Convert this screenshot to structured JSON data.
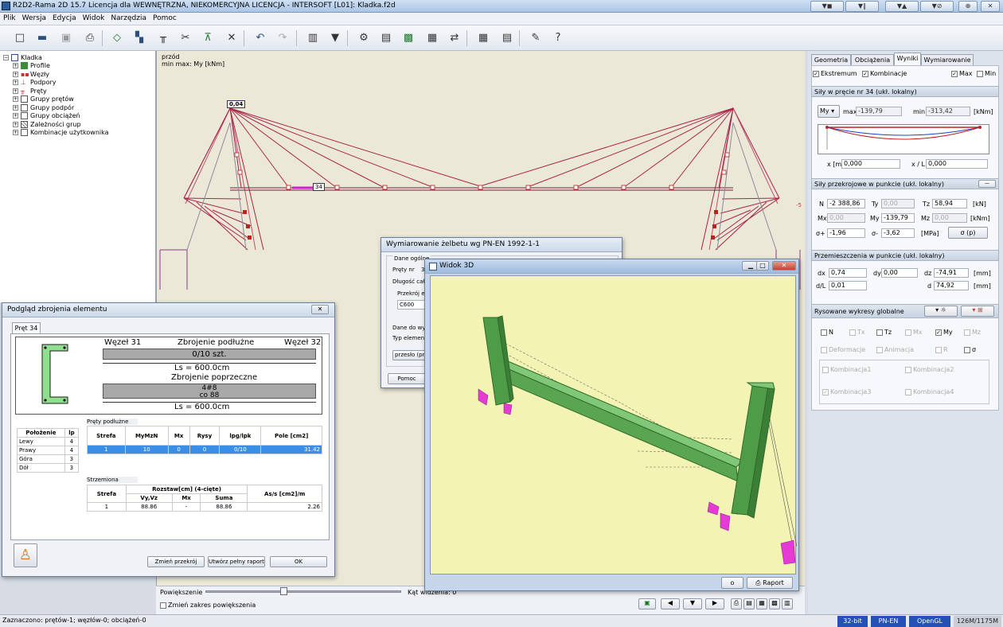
{
  "window": {
    "title": "R2D2-Rama 2D 15.7 Licencja dla WEWNĘTRZNA, NIEKOMERCYJNA LICENCJA - INTERSOFT [L01]: Kladka.f2d",
    "title_buttons": [
      "▼◼",
      "▼∥",
      "▼▲",
      "▼⊘",
      "⊕",
      "✕"
    ]
  },
  "menu": [
    "Plik",
    "Wersja",
    "Edycja",
    "Widok",
    "Narzędzia",
    "Pomoc"
  ],
  "toolbar_icons": [
    "new-file-icon",
    "open-folder-icon",
    "save-icon",
    "print-icon",
    "add-node-icon",
    "move-icon",
    "add-beam-icon",
    "cut-icon",
    "support-icon",
    "delete-icon",
    "undo-icon",
    "redo-icon",
    "grid-icon",
    "filter-icon",
    "calculate-icon",
    "table-icon",
    "view-3d-icon",
    "dimension-icon",
    "align-icon",
    "calculator-icon",
    "report-icon",
    "settings-icon",
    "help-icon"
  ],
  "tree": {
    "root": "Kladka",
    "items": [
      "Profile",
      "Węzły",
      "Podpory",
      "Pręty",
      "Grupy prętów",
      "Grupy podpór",
      "Grupy obciążeń",
      "Zależności grup",
      "Kombinacje użytkownika"
    ]
  },
  "canvas": {
    "view_label": "przód",
    "info_label": "min max: My [kNm]",
    "node_label_1": "0,04",
    "node_label_2": "34",
    "edge_label": "-5"
  },
  "canvas_bottom": {
    "zoom_label": "Powiększenie",
    "angle_label": "Kąt widzenia: 0",
    "zoom_range_checkbox": "Zmień zakres powiększenia",
    "zoom_slider_value": 0.43
  },
  "right_panel": {
    "tabs": [
      "Geometria",
      "Obciążenia",
      "Wyniki",
      "Wymiarowanie"
    ],
    "selected_tab": "Wyniki",
    "check_ekstremum": "Ekstremum",
    "check_kombinacje": "Kombinacje",
    "check_max": "Max",
    "check_min": "Min",
    "forces_header": "Siły w pręcie nr 34 (ukł. lokalny)",
    "force_select": "My",
    "max_label": "max",
    "max_value": "-139,79",
    "min_label": "min",
    "min_value": "-313,42",
    "unit_knm": "[kNm]",
    "x_label": "x [m]",
    "x_value": "0,000",
    "xl_label": "x / L",
    "xl_value": "0,000",
    "section_header": "Siły przekrojowe w punkcie (ukł. lokalny)",
    "N_label": "N",
    "N_value": "-2 388,86",
    "Ty_label": "Ty",
    "Ty_value": "0,00",
    "Tz_label": "Tz",
    "Tz_value": "58,94",
    "unit_kn": "[kN]",
    "Mx_label": "Mx",
    "Mx_value": "0,00",
    "My_label": "My",
    "My_value": "-139,79",
    "Mz_label": "Mz",
    "Mz_value": "0,00",
    "unit_knm2": "[kNm]",
    "sp_label": "σ+",
    "sp_value": "-1,96",
    "sm_label": "σ-",
    "sm_value": "-3,62",
    "unit_mpa": "[MPa]",
    "sigma_btn": "σ (p)",
    "disp_header": "Przemieszczenia w punkcie (ukł. lokalny)",
    "dx_label": "dx",
    "dx_value": "0,74",
    "dy_label": "dy",
    "dy_value": "0,00",
    "dz_label": "dz",
    "dz_value": "-74,91",
    "unit_mm1": "[mm]",
    "dl_label": "d/L",
    "dl_value": "0,01",
    "d_label": "d",
    "d_value": "74,92",
    "unit_mm2": "[mm]",
    "draw_header": "Rysowane wykresy globalne",
    "draw_checks": [
      "N",
      "Tx",
      "Tz",
      "Mx",
      "My",
      "Mz"
    ],
    "deformacje": "Deformacje",
    "animacja": "Animacja",
    "R_label": "R",
    "sigma_label": "σ",
    "komb": [
      "Kombinacja1",
      "Kombinacja2",
      "Kombinacja3",
      "Kombinacja4"
    ]
  },
  "status": {
    "text": "Zaznaczono: prętów-1; węzłów-0; obciążeń-0",
    "bit": "32-bit",
    "norm": "PN-EN",
    "gl": "OpenGL",
    "mem": "126M/1175M"
  },
  "dlg_podglad": {
    "title": "Podgląd zbrojenia elementu",
    "tab": "Pręt 34",
    "node_left": "Węzeł 31",
    "long_label": "Zbrojenie podłużne",
    "node_right": "Węzeł 32",
    "long_bar": "0/10 szt.",
    "ls1": "Ls = 600.0cm",
    "trans_label": "Zbrojenie poprzeczne",
    "trans_bar1": "4#8",
    "trans_bar2": "co 88",
    "ls2": "Ls = 600.0cm",
    "pos_headers": [
      "Położenie",
      "lp"
    ],
    "pos_rows": [
      [
        "Lewy",
        "4"
      ],
      [
        "Prawy",
        "4"
      ],
      [
        "Góra",
        "3"
      ],
      [
        "Dół",
        "3"
      ]
    ],
    "pl_label": "Pręty podłużne",
    "pl_headers": [
      "Strefa",
      "MyMzN",
      "Mx",
      "Rysy",
      "lpg/lpk",
      "Pole [cm2]"
    ],
    "pl_row": [
      "1",
      "10",
      "0",
      "0",
      "0/10",
      "31.42"
    ],
    "str_label": "Strzemiona",
    "str_h1": "Strefa",
    "str_h2": "Rozstaw[cm] (4-cięte)",
    "str_h3": "As/s [cm2]/m",
    "str_sub": [
      "Vy,Vz",
      "Mx",
      "Suma"
    ],
    "str_row": [
      "1",
      "88.86",
      "-",
      "88.86",
      "2.26"
    ],
    "btn_change": "Zmień przekrój",
    "btn_report": "Utwórz pełny raport",
    "btn_ok": "OK"
  },
  "dlg_wym": {
    "title": "Wymiarowanie żelbetu wg PN-EN 1992-1-1",
    "group": "Dane ogólne",
    "prety_label": "Pręty nr",
    "prety_value": "3",
    "dlugosc": "Długość całk",
    "przekroj": "Przekrój ele",
    "concrete": "C600",
    "dane_do": "Dane do wym",
    "typ": "Typ element",
    "combo": "przesło (pro",
    "pomoc": "Pomoc"
  },
  "dlg_3d": {
    "title": "Widok 3D",
    "btn_o": "o",
    "btn_raport": "Raport"
  }
}
